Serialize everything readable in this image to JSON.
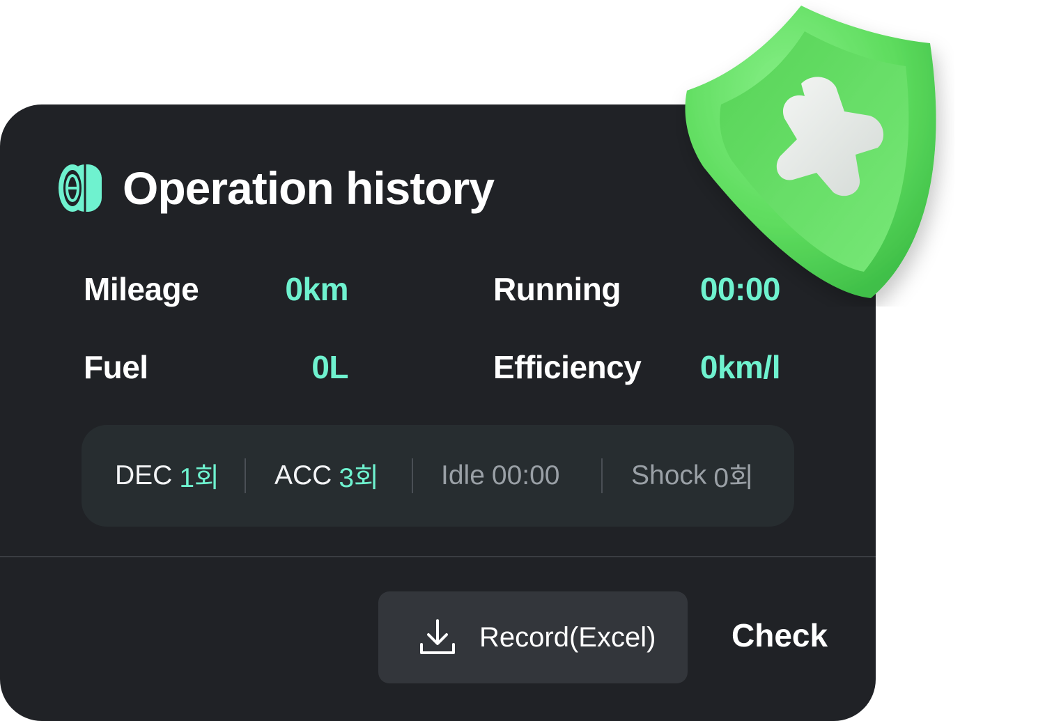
{
  "header": {
    "title": "Operation history",
    "icon": "tire-icon"
  },
  "stats": {
    "mileage": {
      "label": "Mileage",
      "value": "0km"
    },
    "running": {
      "label": "Running",
      "value": "00:00"
    },
    "fuel": {
      "label": "Fuel",
      "value": "0L"
    },
    "efficiency": {
      "label": "Efficiency",
      "value": "0km/l"
    }
  },
  "counters": {
    "dec": {
      "label": "DEC",
      "value": "1회"
    },
    "acc": {
      "label": "ACC",
      "value": "3회"
    },
    "idle": {
      "label": "Idle",
      "value": "00:00"
    },
    "shock": {
      "label": "Shock",
      "value": "0회"
    }
  },
  "actions": {
    "record_label": "Record(Excel)",
    "check_label": "Check"
  },
  "decoration": {
    "shield_icon": "shield-plus-icon"
  },
  "colors": {
    "card_bg": "#202226",
    "accent": "#6ff2cf",
    "shield_green": "#6be36b"
  }
}
